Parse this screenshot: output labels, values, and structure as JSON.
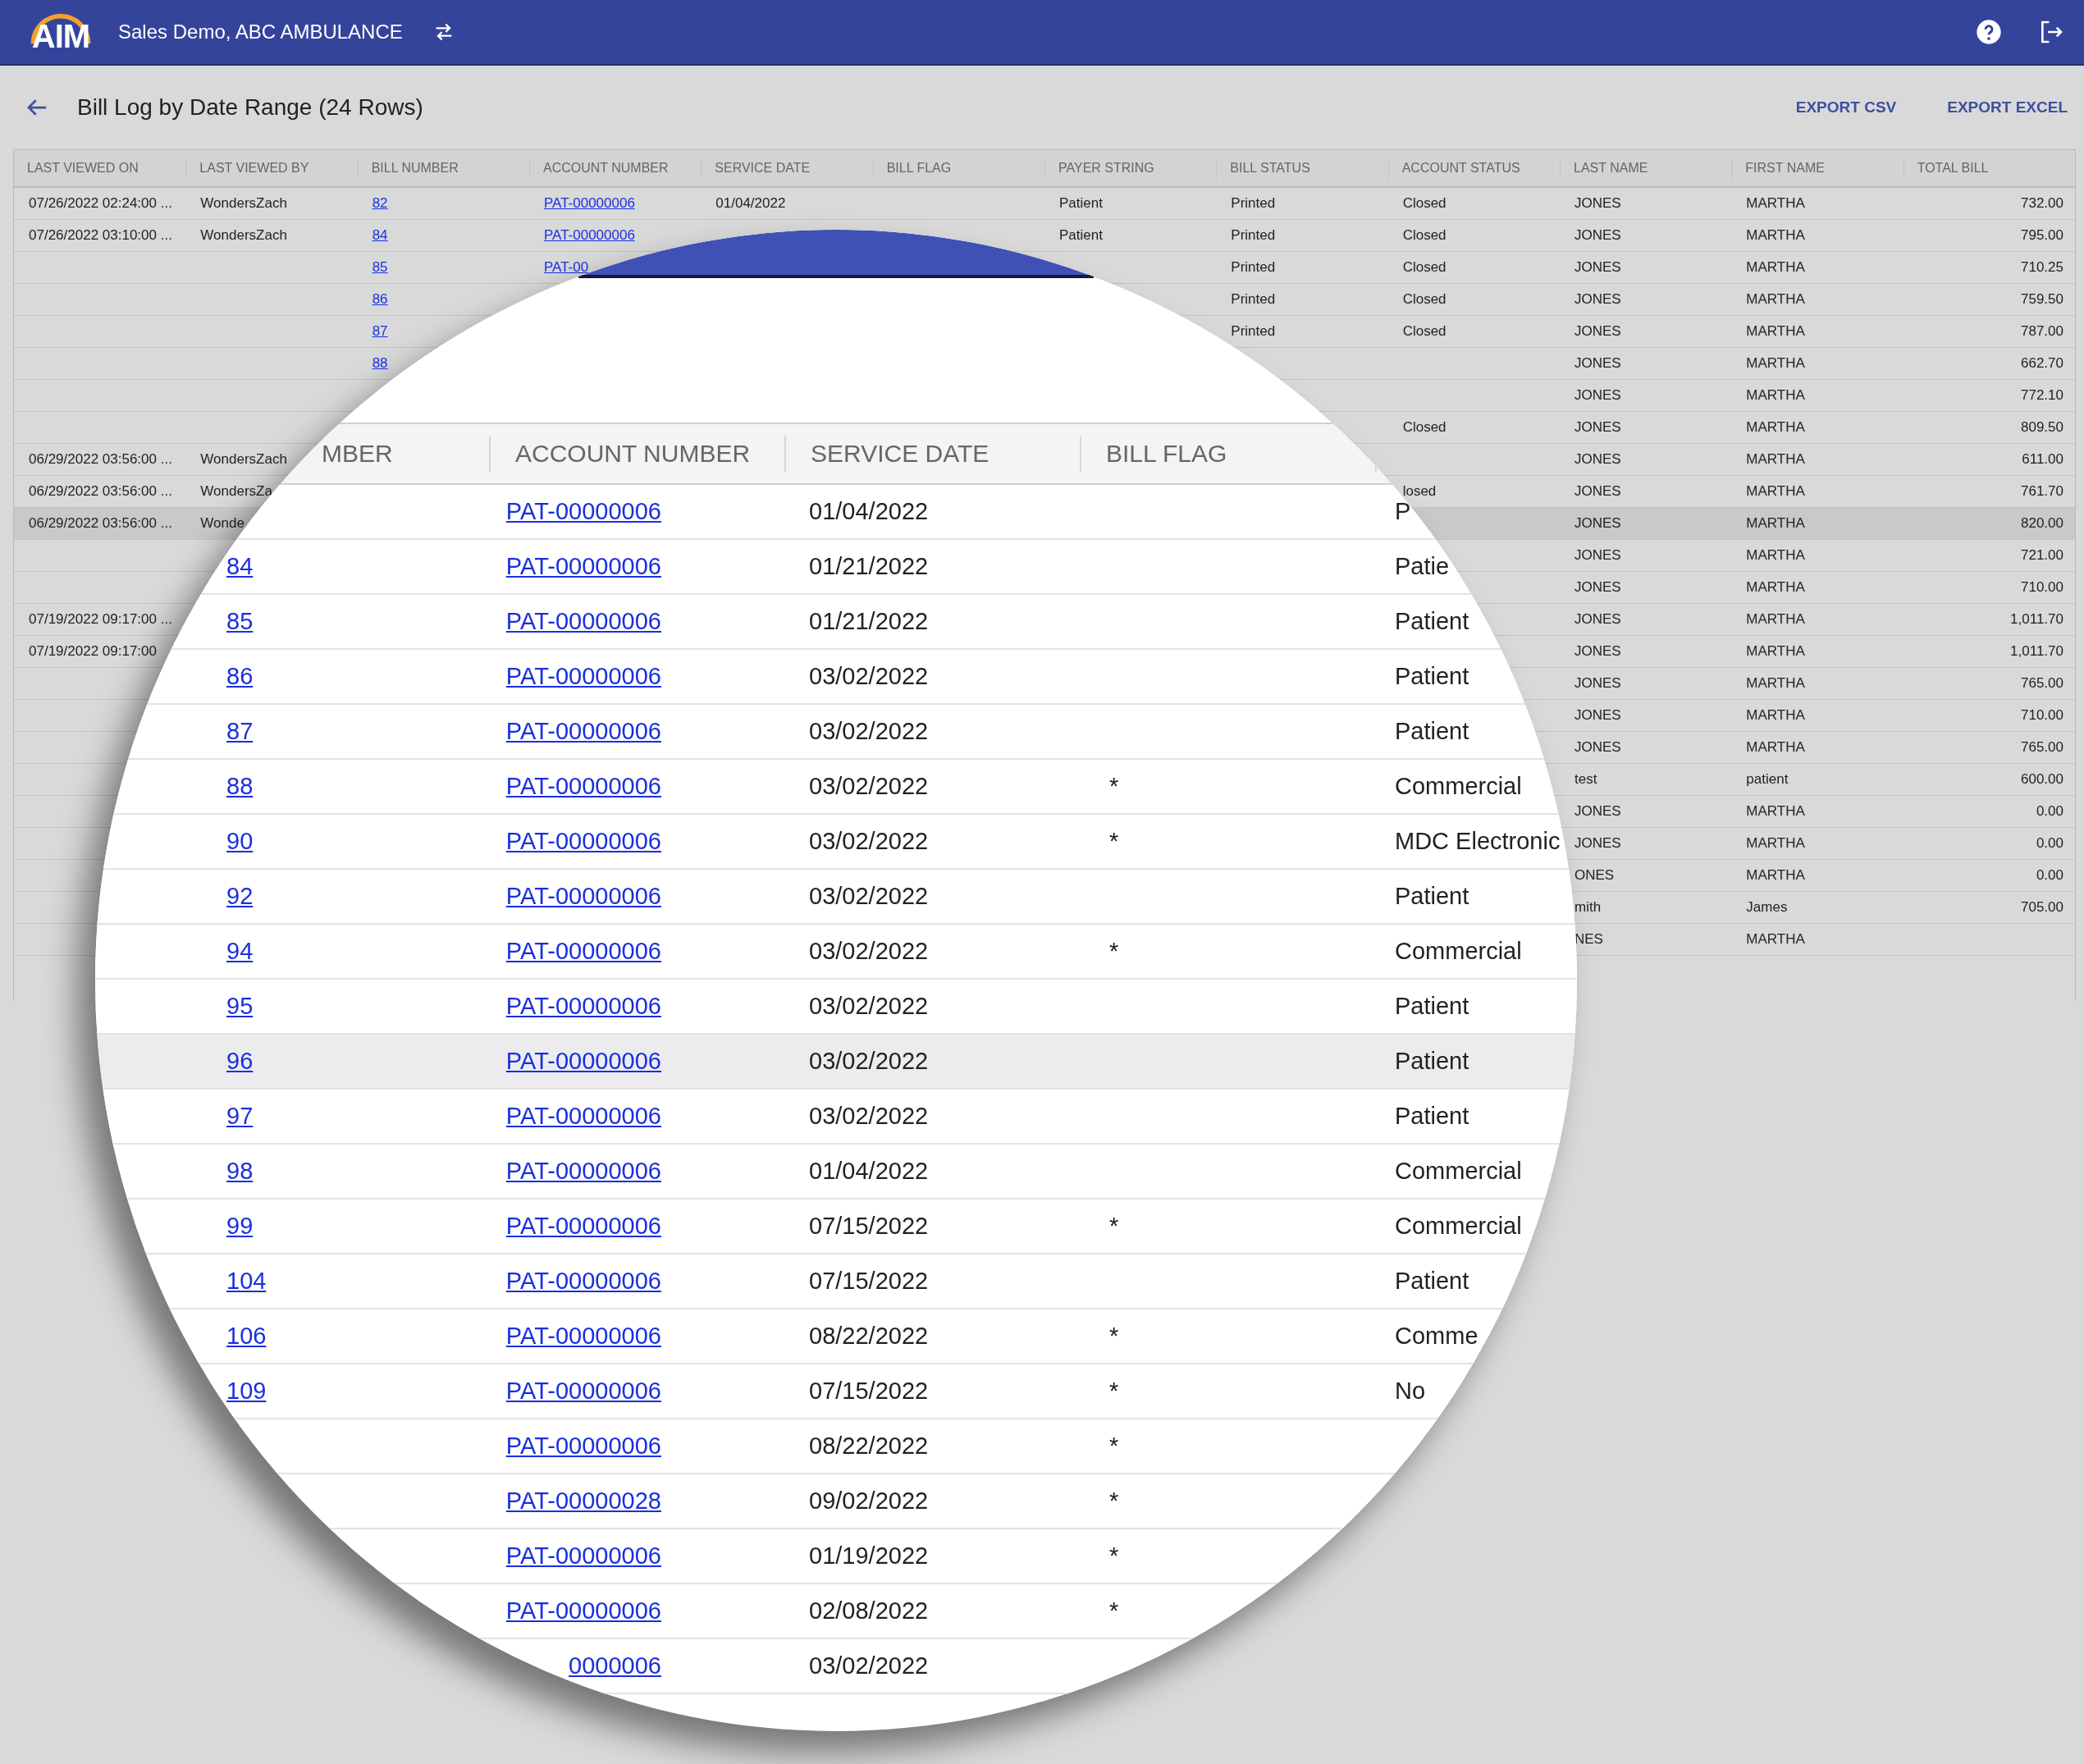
{
  "app_bar": {
    "logo": "AIM",
    "organization": "Sales Demo, ABC AMBULANCE"
  },
  "page": {
    "title": "Bill Log by Date Range (24 Rows)",
    "actions": [
      "EXPORT CSV",
      "EXPORT EXCEL"
    ]
  },
  "table": {
    "columns": [
      {
        "label": "LAST VIEWED ON",
        "kind": "text"
      },
      {
        "label": "LAST VIEWED BY",
        "kind": "text"
      },
      {
        "label": "BILL NUMBER",
        "kind": "link"
      },
      {
        "label": "ACCOUNT NUMBER",
        "kind": "link"
      },
      {
        "label": "SERVICE DATE",
        "kind": "text"
      },
      {
        "label": "BILL FLAG",
        "kind": "text"
      },
      {
        "label": "PAYER STRING",
        "kind": "text"
      },
      {
        "label": "BILL STATUS",
        "kind": "text"
      },
      {
        "label": "ACCOUNT STATUS",
        "kind": "text"
      },
      {
        "label": "LAST NAME",
        "kind": "text"
      },
      {
        "label": "FIRST NAME",
        "kind": "text"
      },
      {
        "label": "TOTAL BILL",
        "kind": "number"
      }
    ],
    "rows": [
      {
        "selected": false,
        "cells": [
          "07/26/2022 02:24:00 ...",
          "WondersZach",
          "82",
          "PAT-00000006",
          "01/04/2022",
          null,
          "Patient",
          "Printed",
          "Closed",
          "JONES",
          "MARTHA",
          "732.00"
        ]
      },
      {
        "selected": false,
        "cells": [
          "07/26/2022 03:10:00 ...",
          "WondersZach",
          "84",
          "PAT-00000006",
          null,
          null,
          "Patient",
          "Printed",
          "Closed",
          "JONES",
          "MARTHA",
          "795.00"
        ]
      },
      {
        "selected": false,
        "cells": [
          null,
          null,
          "85",
          "PAT-00",
          null,
          null,
          null,
          "Printed",
          "Closed",
          "JONES",
          "MARTHA",
          "710.25"
        ]
      },
      {
        "selected": false,
        "cells": [
          null,
          null,
          "86",
          null,
          null,
          null,
          null,
          "Printed",
          "Closed",
          "JONES",
          "MARTHA",
          "759.50"
        ]
      },
      {
        "selected": false,
        "cells": [
          null,
          null,
          "87",
          null,
          null,
          null,
          null,
          "Printed",
          "Closed",
          "JONES",
          "MARTHA",
          "787.00"
        ]
      },
      {
        "selected": false,
        "cells": [
          null,
          null,
          "88",
          null,
          null,
          null,
          null,
          null,
          null,
          "JONES",
          "MARTHA",
          "662.70"
        ]
      },
      {
        "selected": false,
        "cells": [
          null,
          null,
          null,
          null,
          null,
          null,
          null,
          null,
          null,
          "JONES",
          "MARTHA",
          "772.10"
        ]
      },
      {
        "selected": false,
        "cells": [
          null,
          null,
          null,
          null,
          null,
          null,
          null,
          null,
          "Closed",
          "JONES",
          "MARTHA",
          "809.50"
        ]
      },
      {
        "selected": false,
        "cells": [
          "06/29/2022 03:56:00 ...",
          "WondersZach",
          null,
          null,
          null,
          null,
          null,
          null,
          null,
          "JONES",
          "MARTHA",
          "611.00"
        ]
      },
      {
        "selected": false,
        "cells": [
          "06/29/2022 03:56:00 ...",
          "WondersZa",
          null,
          null,
          null,
          null,
          null,
          null,
          "losed",
          "JONES",
          "MARTHA",
          "761.70"
        ]
      },
      {
        "selected": true,
        "cells": [
          "06/29/2022 03:56:00 ...",
          "Wonde",
          null,
          null,
          null,
          null,
          null,
          null,
          null,
          "JONES",
          "MARTHA",
          "820.00"
        ]
      },
      {
        "selected": false,
        "cells": [
          null,
          null,
          null,
          null,
          null,
          null,
          null,
          null,
          null,
          "JONES",
          "MARTHA",
          "721.00"
        ]
      },
      {
        "selected": false,
        "cells": [
          null,
          null,
          null,
          null,
          null,
          null,
          null,
          null,
          null,
          "JONES",
          "MARTHA",
          "710.00"
        ]
      },
      {
        "selected": false,
        "cells": [
          "07/19/2022 09:17:00 ...",
          null,
          null,
          null,
          null,
          null,
          null,
          null,
          null,
          "JONES",
          "MARTHA",
          "1,011.70"
        ]
      },
      {
        "selected": false,
        "cells": [
          "07/19/2022 09:17:00",
          null,
          null,
          null,
          null,
          null,
          null,
          null,
          null,
          "JONES",
          "MARTHA",
          "1,011.70"
        ]
      },
      {
        "selected": false,
        "cells": [
          null,
          null,
          null,
          null,
          null,
          null,
          null,
          null,
          null,
          "JONES",
          "MARTHA",
          "765.00"
        ]
      },
      {
        "selected": false,
        "cells": [
          null,
          null,
          null,
          null,
          null,
          null,
          null,
          null,
          null,
          "JONES",
          "MARTHA",
          "710.00"
        ]
      },
      {
        "selected": false,
        "cells": [
          null,
          null,
          null,
          null,
          null,
          null,
          null,
          null,
          null,
          "JONES",
          "MARTHA",
          "765.00"
        ]
      },
      {
        "selected": false,
        "cells": [
          null,
          null,
          null,
          null,
          null,
          null,
          null,
          null,
          null,
          "test",
          "patient",
          "600.00"
        ]
      },
      {
        "selected": false,
        "cells": [
          null,
          null,
          null,
          null,
          null,
          null,
          null,
          null,
          null,
          "JONES",
          "MARTHA",
          "0.00"
        ]
      },
      {
        "selected": false,
        "cells": [
          null,
          null,
          null,
          null,
          null,
          null,
          null,
          null,
          null,
          "JONES",
          "MARTHA",
          "0.00"
        ]
      },
      {
        "selected": false,
        "cells": [
          null,
          null,
          null,
          null,
          null,
          null,
          null,
          null,
          null,
          "ONES",
          "MARTHA",
          "0.00"
        ]
      },
      {
        "selected": false,
        "cells": [
          null,
          null,
          null,
          null,
          null,
          null,
          null,
          null,
          null,
          "mith",
          "James",
          "705.00"
        ]
      },
      {
        "selected": false,
        "cells": [
          null,
          null,
          null,
          null,
          null,
          null,
          null,
          null,
          null,
          "NES",
          "MARTHA",
          null
        ]
      }
    ]
  },
  "magnifier": {
    "columns": [
      {
        "label": "MBER",
        "kind": "link"
      },
      {
        "label": "ACCOUNT NUMBER",
        "kind": "link"
      },
      {
        "label": "SERVICE DATE",
        "kind": "text"
      },
      {
        "label": "BILL FLAG",
        "kind": "text"
      },
      {
        "kind": "text"
      }
    ],
    "rows": [
      {
        "selected": false,
        "cells": [
          null,
          "PAT-00000006",
          "01/04/2022",
          null,
          "P"
        ]
      },
      {
        "selected": false,
        "cells": [
          "84",
          "PAT-00000006",
          "01/21/2022",
          null,
          "Patie"
        ]
      },
      {
        "selected": false,
        "cells": [
          "85",
          "PAT-00000006",
          "01/21/2022",
          null,
          "Patient"
        ]
      },
      {
        "selected": false,
        "cells": [
          "86",
          "PAT-00000006",
          "03/02/2022",
          null,
          "Patient"
        ]
      },
      {
        "selected": false,
        "cells": [
          "87",
          "PAT-00000006",
          "03/02/2022",
          null,
          "Patient"
        ]
      },
      {
        "selected": false,
        "cells": [
          "88",
          "PAT-00000006",
          "03/02/2022",
          "*",
          "Commercial"
        ]
      },
      {
        "selected": false,
        "cells": [
          "90",
          "PAT-00000006",
          "03/02/2022",
          "*",
          "MDC Electronic"
        ]
      },
      {
        "selected": false,
        "cells": [
          "92",
          "PAT-00000006",
          "03/02/2022",
          null,
          "Patient"
        ]
      },
      {
        "selected": false,
        "cells": [
          "94",
          "PAT-00000006",
          "03/02/2022",
          "*",
          "Commercial"
        ]
      },
      {
        "selected": false,
        "cells": [
          "95",
          "PAT-00000006",
          "03/02/2022",
          null,
          "Patient"
        ]
      },
      {
        "selected": true,
        "cells": [
          "96",
          "PAT-00000006",
          "03/02/2022",
          null,
          "Patient"
        ]
      },
      {
        "selected": false,
        "cells": [
          "97",
          "PAT-00000006",
          "03/02/2022",
          null,
          "Patient"
        ]
      },
      {
        "selected": false,
        "cells": [
          "98",
          "PAT-00000006",
          "01/04/2022",
          null,
          "Commercial"
        ]
      },
      {
        "selected": false,
        "cells": [
          "99",
          "PAT-00000006",
          "07/15/2022",
          "*",
          "Commercial"
        ]
      },
      {
        "selected": false,
        "cells": [
          "104",
          "PAT-00000006",
          "07/15/2022",
          null,
          "Patient"
        ]
      },
      {
        "selected": false,
        "cells": [
          "106",
          "PAT-00000006",
          "08/22/2022",
          "*",
          "Comme"
        ]
      },
      {
        "selected": false,
        "cells": [
          "109",
          "PAT-00000006",
          "07/15/2022",
          "*",
          "No"
        ]
      },
      {
        "selected": false,
        "cells": [
          null,
          "PAT-00000006",
          "08/22/2022",
          "*",
          null
        ]
      },
      {
        "selected": false,
        "cells": [
          null,
          "PAT-00000028",
          "09/02/2022",
          "*",
          null
        ]
      },
      {
        "selected": false,
        "cells": [
          null,
          "PAT-00000006",
          "01/19/2022",
          "*",
          null
        ]
      },
      {
        "selected": false,
        "cells": [
          null,
          "PAT-00000006",
          "02/08/2022",
          "*",
          null
        ]
      },
      {
        "selected": false,
        "cells": [
          null,
          "0000006",
          "03/02/2022",
          null,
          null
        ]
      }
    ]
  }
}
